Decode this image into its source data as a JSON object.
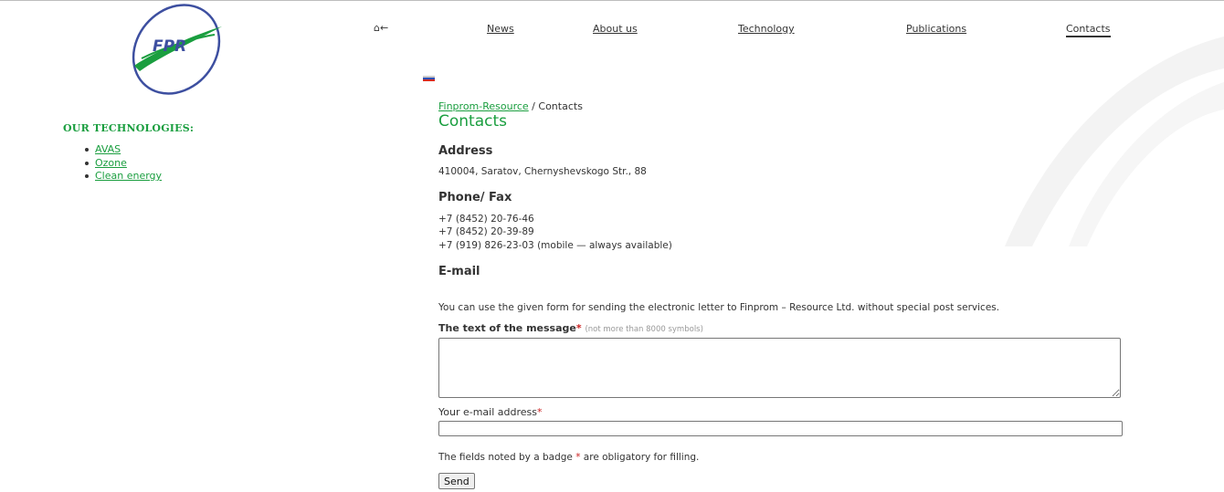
{
  "logo": {
    "text": "FPR",
    "colors": {
      "ring": "#3d4fa0",
      "swoosh": "#1a9e3f"
    }
  },
  "nav": {
    "home_label": "⌂←",
    "items": [
      {
        "label": "News"
      },
      {
        "label": "About us"
      },
      {
        "label": "Technology"
      },
      {
        "label": "Publications"
      },
      {
        "label": "Contacts",
        "active": true
      }
    ]
  },
  "sidebar": {
    "title": "OUR TECHNOLOGIES:",
    "items": [
      {
        "label": "AVAS"
      },
      {
        "label": "Ozone"
      },
      {
        "label": "Clean energy"
      }
    ]
  },
  "breadcrumb": {
    "home": "Finprom-Resource",
    "separator": " / ",
    "current": "Contacts"
  },
  "page_title": "Contacts",
  "address": {
    "heading": "Address",
    "text": "410004, Saratov, Chernyshevskogo Str., 88"
  },
  "phone": {
    "heading": "Phone/ Fax",
    "lines": [
      "+7 (8452) 20-76-46",
      "+7 (8452) 20-39-89",
      "+7 (919) 826-23-03 (mobile — always available)"
    ]
  },
  "email_section": {
    "heading": "E-mail",
    "intro": "You can use the given form for sending the electronic letter to Finprom – Resource Ltd. without special post services."
  },
  "form": {
    "message_label": "The text of the message",
    "required_mark": "*",
    "message_hint": "(not more than 8000 symbols)",
    "message_value": "",
    "email_label": "Your e-mail address",
    "email_value": "",
    "note_before": "The fields noted by a badge ",
    "note_after": " are obligatory for filling.",
    "send_label": "Send"
  },
  "colors": {
    "accent": "#1a9e3f",
    "required": "#cc2222",
    "text": "#333333"
  }
}
